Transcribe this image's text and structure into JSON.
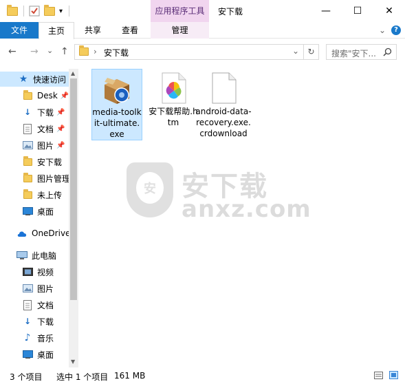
{
  "title_bar": {
    "contextual_tab": "应用程序工具",
    "window_title": "安下载",
    "minimize": "—",
    "maximize": "☐",
    "close": "✕"
  },
  "ribbon": {
    "tabs": [
      "文件",
      "主页",
      "共享",
      "查看",
      "管理"
    ],
    "expand": "⌄",
    "help": "?"
  },
  "address": {
    "back": "←",
    "forward": "→",
    "recent": "⌄",
    "up": "↑",
    "path": "安下载",
    "refresh": "↻",
    "dropdown": "⌄",
    "search_placeholder": "搜索\"安下..."
  },
  "nav": {
    "quick_access": "快速访问",
    "items": [
      {
        "label": "Desk",
        "icon": "folder-icon",
        "pinned": true
      },
      {
        "label": "下载",
        "icon": "download-icon",
        "pinned": true
      },
      {
        "label": "文档",
        "icon": "document-icon",
        "pinned": true
      },
      {
        "label": "图片",
        "icon": "pictures-icon",
        "pinned": true
      },
      {
        "label": "安下载",
        "icon": "folder-icon"
      },
      {
        "label": "图片管理",
        "icon": "folder-icon"
      },
      {
        "label": "未上传",
        "icon": "folder-icon"
      },
      {
        "label": "桌面",
        "icon": "desktop-icon"
      }
    ],
    "onedrive": "OneDrive",
    "this_pc": "此电脑",
    "pc_items": [
      {
        "label": "视频",
        "icon": "video-icon"
      },
      {
        "label": "图片",
        "icon": "pictures-icon"
      },
      {
        "label": "文档",
        "icon": "document-icon"
      },
      {
        "label": "下载",
        "icon": "download-icon"
      },
      {
        "label": "音乐",
        "icon": "music-icon"
      },
      {
        "label": "桌面",
        "icon": "desktop-icon"
      }
    ]
  },
  "files": [
    {
      "name": "media-toolkit-ultimate.exe",
      "icon": "installer-box-icon",
      "selected": true
    },
    {
      "name": "安下载帮助.htm",
      "icon": "photos-app-icon",
      "selected": false
    },
    {
      "name": "android-data-recovery.exe.crdownload",
      "icon": "blank-file-icon",
      "selected": false
    }
  ],
  "watermark": {
    "shield": "安",
    "cn": "安下载",
    "en": "anxz.com"
  },
  "status": {
    "count": "3 个项目",
    "selected": "选中 1 个项目",
    "size": "161 MB"
  },
  "colors": {
    "accent": "#1979ca",
    "selection": "#cce8ff",
    "context_tab": "#f1d5ef",
    "folder": "#f5cc5b"
  }
}
